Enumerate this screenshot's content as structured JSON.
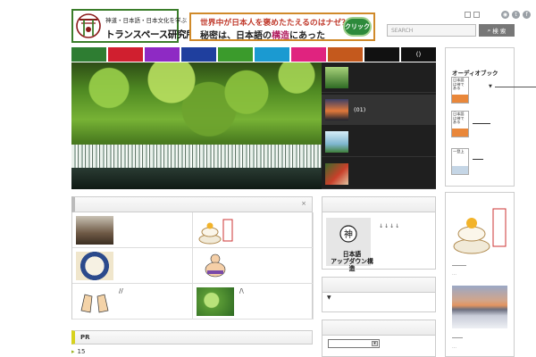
{
  "header": {
    "logo_tagline": "神道・日本語・日本文化を学ぶ",
    "logo_name": "トランスペース研究所",
    "banner_line1": "世界中が日本人を褒めたたえるのはナゼ？",
    "banner_line2_a": "秘密は、日本語の",
    "banner_line2_highlight": "構造",
    "banner_line2_b": "にあった",
    "banner_button": "クリック",
    "search_placeholder": "SEARCH",
    "search_button": "検 索"
  },
  "nav": {
    "items": [
      {
        "label": "",
        "color": "#2e7d32"
      },
      {
        "label": "",
        "color": "#d01f2f"
      },
      {
        "label": "",
        "color": "#8e2ac4"
      },
      {
        "label": "",
        "color": "#1f3f9e"
      },
      {
        "label": "",
        "color": "#3b9b2c"
      },
      {
        "label": "",
        "color": "#1b9ad1"
      },
      {
        "label": "",
        "color": "#e0237f"
      },
      {
        "label": "",
        "color": "#c4591d"
      },
      {
        "label": "",
        "color": "#111111"
      },
      {
        "label": "()",
        "color": "#111111"
      }
    ]
  },
  "slider": {
    "thumbs": [
      {
        "label": "",
        "kind": "forest"
      },
      {
        "label": "(01)",
        "kind": "sunset"
      },
      {
        "label": "",
        "kind": "sky"
      },
      {
        "label": "",
        "kind": "autumn"
      }
    ]
  },
  "widgets": {
    "left_close": "×",
    "cells": [
      {
        "text": "",
        "kind": "camp"
      },
      {
        "text": "",
        "kind": "kagami"
      },
      {
        "text": "",
        "kind": "calligraphy"
      },
      {
        "text": "",
        "kind": "sumo"
      },
      {
        "text": "//",
        "kind": "hands"
      },
      {
        "text": "/\\",
        "kind": "leaf"
      }
    ],
    "pr_title": "PR",
    "pr_item": "15"
  },
  "middle": {
    "kami_char": "神",
    "kami_label_line1": "日本語",
    "kami_label_line2": "アップダウン構造",
    "kami_arrows": "↓↓↓↓",
    "triangle": "▼"
  },
  "right": {
    "audio_title": "オーディオブック",
    "book1_text": "日本語は神である",
    "book2_text": "日本語は神である",
    "book3_text": "一登上"
  },
  "colors": {
    "accent_green": "#3a7d2a",
    "banner_border": "#d08a2a",
    "highlight": "#b21e60"
  }
}
